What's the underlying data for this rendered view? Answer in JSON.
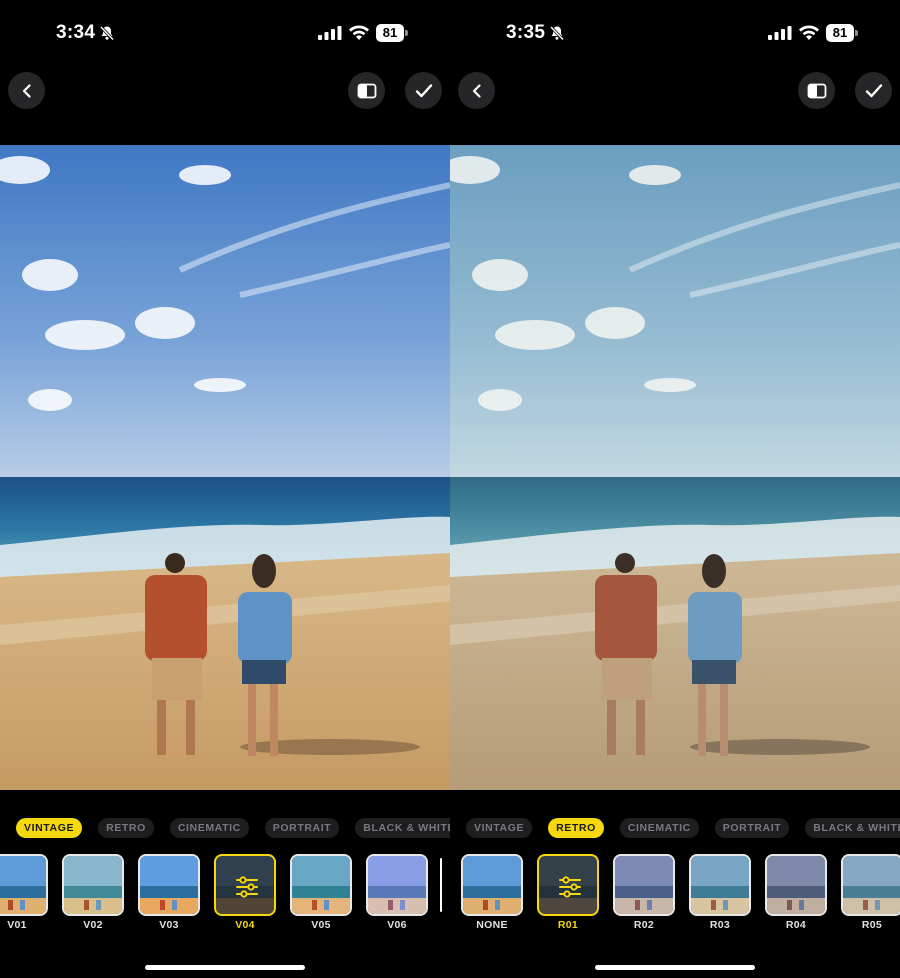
{
  "screens": [
    {
      "time": "3:34",
      "battery": "81",
      "categories": [
        "VINTAGE",
        "RETRO",
        "CINEMATIC",
        "PORTRAIT",
        "BLACK & WHITE"
      ],
      "active_category": "VINTAGE",
      "filters": [
        "V01",
        "V02",
        "V03",
        "V04",
        "V05",
        "V06"
      ],
      "selected_filter": "V04"
    },
    {
      "time": "3:35",
      "battery": "81",
      "categories": [
        "VINTAGE",
        "RETRO",
        "CINEMATIC",
        "PORTRAIT",
        "BLACK & WHITE"
      ],
      "active_category": "RETRO",
      "filters": [
        "NONE",
        "R01",
        "R02",
        "R03",
        "R04",
        "R05"
      ],
      "selected_filter": "R01"
    }
  ],
  "icons": {
    "back": "chevron-left-icon",
    "compare": "split-compare-icon",
    "done": "checkmark-icon",
    "adjust": "sliders-icon",
    "silent": "bell-slash-icon",
    "signal": "cellular-signal-icon",
    "wifi": "wifi-icon"
  },
  "colors": {
    "accent": "#f5d80f",
    "background": "#000000",
    "chip": "#1e1e20"
  }
}
